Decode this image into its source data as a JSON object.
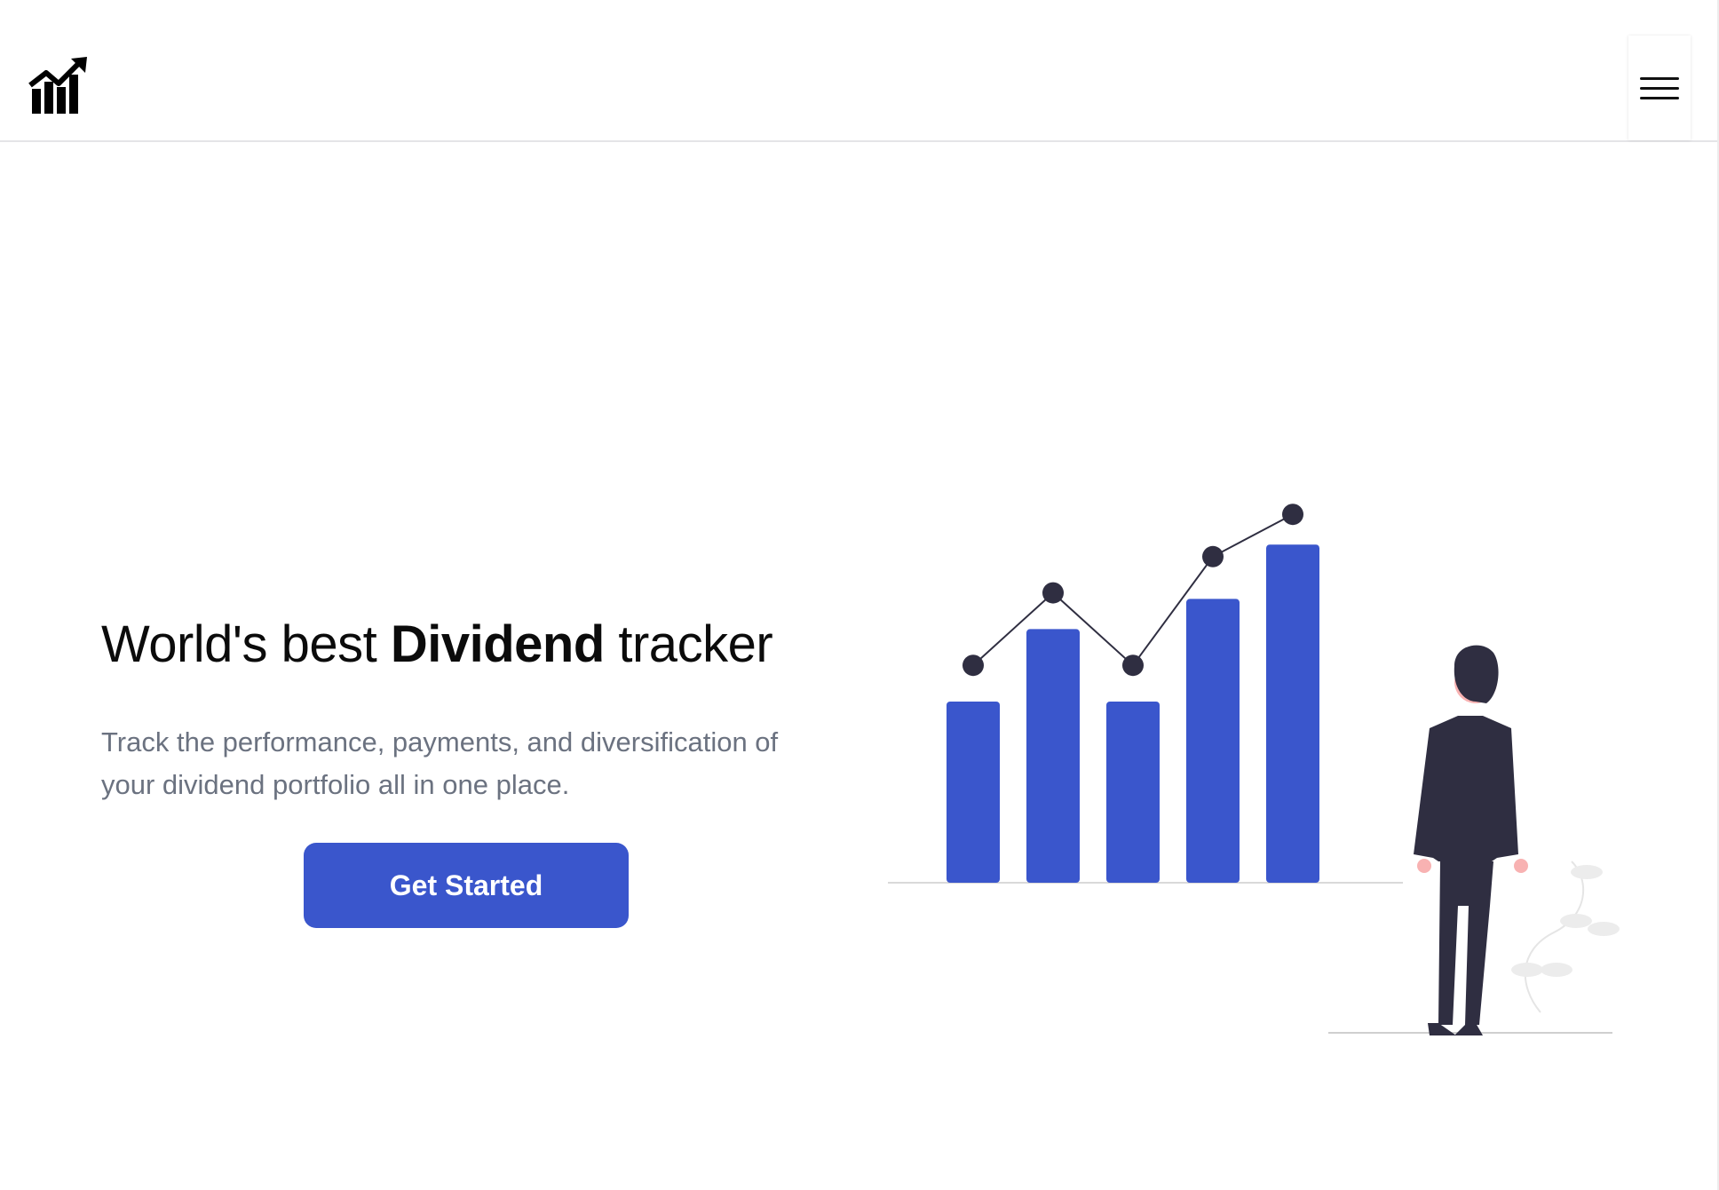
{
  "hero": {
    "title_pre": "World's best ",
    "title_bold": "Dividend",
    "title_post": " tracker",
    "subtitle_line1": "Track the performance, payments, and diversification of",
    "subtitle_line2": "your dividend portfolio all in one place.",
    "cta_label": "Get Started"
  },
  "colors": {
    "accent": "#3a56cc",
    "text_dark": "#0b0b0b",
    "text_muted": "#6b7280",
    "figure_dark": "#2f2e41"
  },
  "icons": {
    "logo": "chart-growth-icon",
    "menu": "hamburger-menu-icon"
  },
  "illustration": {
    "bar_values": [
      3,
      4.2,
      3,
      4.7,
      5.6
    ],
    "line_values": [
      3.6,
      4.8,
      3.6,
      5.4,
      6.1
    ]
  }
}
